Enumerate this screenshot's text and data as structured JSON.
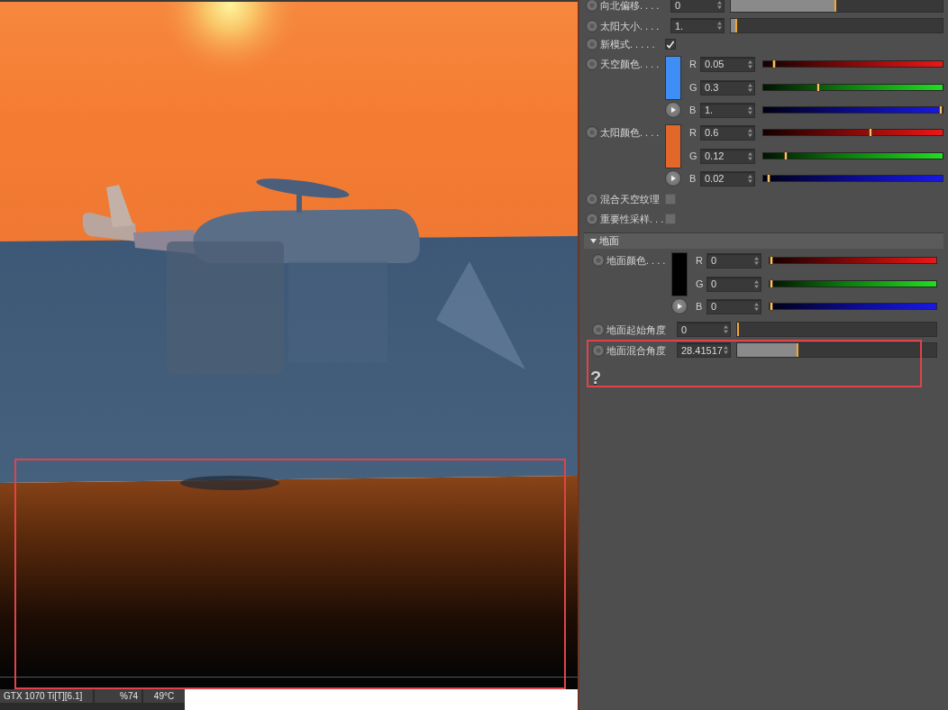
{
  "render_view": {
    "status_bar": [
      {
        "kind": "gpu",
        "text": "GTX 1070 Ti[T][6.1]"
      },
      {
        "kind": "usage",
        "text": "%74"
      },
      {
        "kind": "temperature",
        "text": "49°C"
      }
    ]
  },
  "parameters": [
    {
      "kind": "number",
      "label": "向北偏移. . . .",
      "value": "0",
      "level": 0.49
    },
    {
      "kind": "number",
      "label": "太阳大小. . . .",
      "value": "1.",
      "level": 0.02
    },
    {
      "kind": "checkbox",
      "label": "新模式. . . . .",
      "checked": true
    },
    {
      "kind": "color",
      "label": "天空颜色. . . .",
      "color": "#3f8ef5",
      "channels": [
        {
          "name": "R",
          "value": "0.05",
          "level": 0.05
        },
        {
          "name": "G",
          "value": "0.3",
          "level": 0.3
        },
        {
          "name": "B",
          "value": "1.",
          "level": 1
        }
      ]
    },
    {
      "kind": "color",
      "label": "太阳颜色. . . .",
      "color": "#e2682a",
      "channels": [
        {
          "name": "R",
          "value": "0.6",
          "level": 0.6
        },
        {
          "name": "G",
          "value": "0.12",
          "level": 0.12
        },
        {
          "name": "B",
          "value": "0.02",
          "level": 0.02
        }
      ]
    },
    {
      "kind": "checkbox",
      "label": "混合天空纹理",
      "checked": false
    },
    {
      "kind": "checkbox",
      "label": "重要性采样. . .",
      "checked": false
    }
  ],
  "ground_section": {
    "title": "地面",
    "expanded": true,
    "parameters": [
      {
        "kind": "color",
        "label": "地面颜色. . . .",
        "color": "#000000",
        "channels": [
          {
            "name": "R",
            "value": "0",
            "level": 0
          },
          {
            "name": "G",
            "value": "0",
            "level": 0
          },
          {
            "name": "B",
            "value": "0",
            "level": 0
          }
        ]
      },
      {
        "kind": "number",
        "label": "地面起始角度",
        "value": "0",
        "level": 0
      },
      {
        "kind": "number",
        "label": "地面混合角度",
        "value": "28.41517",
        "level": 0.3
      }
    ]
  },
  "help": {
    "label": "?"
  }
}
